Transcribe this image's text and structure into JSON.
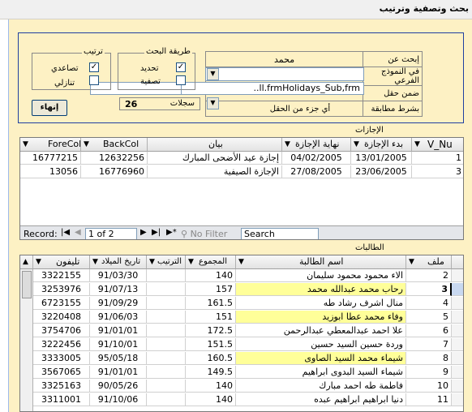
{
  "window": {
    "title": "بحث وتصفية وترتيب"
  },
  "search_panel": {
    "search_for_label": "إبحث عن",
    "search_for_value": "محمد",
    "subform_label": "في النموذج الفرعي",
    "within_field_label": "ضمن حقل",
    "within_field_value": "..ll.frmHolidays_Sub,frm",
    "match_label": "بشرط مطابقة",
    "match_value": "أي جزء من الحقل",
    "records_label": "سجلات",
    "records_count": "26",
    "close_button": "إنهاء",
    "search_method_group": "طريقة البحث",
    "method_select": "تحديد",
    "method_filter": "تصفية",
    "sort_group": "ترتيب",
    "sort_asc": "تصاعدي",
    "sort_desc": "تنازلي"
  },
  "holidays": {
    "section_title": "الإجازات",
    "columns": [
      "V_Nu",
      "بدء الإجازة",
      "نهاية الإجازة",
      "بيان",
      "BackCol",
      "ForeCol"
    ],
    "rows": [
      {
        "num": "1",
        "start": "13/01/2005",
        "end": "04/02/2005",
        "desc": "إجازة عيد الأضحى المبارك",
        "back": "12632256",
        "fore": "16777215"
      },
      {
        "num": "3",
        "start": "23/06/2005",
        "end": "27/08/2005",
        "desc": "الإجازة الصيفية",
        "back": "16776960",
        "fore": "13056"
      }
    ],
    "nav": {
      "record_label": "Record:",
      "position": "1 of 2",
      "filter": "No Filter",
      "search": "Search"
    }
  },
  "students": {
    "section_title": "الطالبات",
    "columns": [
      "ملف",
      "اسم الطالبة",
      "المجموع",
      "الترتيب",
      "تاريخ الميلاد",
      "تليفون"
    ],
    "rows": [
      {
        "file": "2",
        "name": "الاء محمود محمود سليمان",
        "total": "140",
        "rank": "",
        "dob": "91/03/30",
        "phone": "3322155",
        "hl": false
      },
      {
        "file": "3",
        "name": "رحاب محمد عبدالله محمد",
        "total": "157",
        "rank": "",
        "dob": "91/07/13",
        "phone": "3253976",
        "hl": true
      },
      {
        "file": "4",
        "name": "منال اشرف رشاد طه",
        "total": "161.5",
        "rank": "",
        "dob": "91/09/29",
        "phone": "6723155",
        "hl": false
      },
      {
        "file": "5",
        "name": "وفاء محمد عطا ابوزيد",
        "total": "151",
        "rank": "",
        "dob": "91/06/03",
        "phone": "3220408",
        "hl": true
      },
      {
        "file": "6",
        "name": "علا احمد عبدالمعطي عبدالرحمن",
        "total": "172.5",
        "rank": "",
        "dob": "91/01/01",
        "phone": "3754706",
        "hl": false
      },
      {
        "file": "7",
        "name": "وردة حسين السيد حسين",
        "total": "151.5",
        "rank": "",
        "dob": "91/10/01",
        "phone": "3222456",
        "hl": false
      },
      {
        "file": "8",
        "name": "شيماء محمد السيد الصاوى",
        "total": "160.5",
        "rank": "",
        "dob": "95/05/18",
        "phone": "3333005",
        "hl": true
      },
      {
        "file": "9",
        "name": "شيماء السيد البدوى ابراهيم",
        "total": "149.5",
        "rank": "",
        "dob": "91/01/01",
        "phone": "3567065",
        "hl": false
      },
      {
        "file": "10",
        "name": "فاطمة طه احمد مبارك",
        "total": "140",
        "rank": "",
        "dob": "90/05/26",
        "phone": "3325163",
        "hl": false
      },
      {
        "file": "11",
        "name": "دنيا ابراهيم ابراهيم عبده",
        "total": "140",
        "rank": "",
        "dob": "91/10/06",
        "phone": "3311001",
        "hl": false
      }
    ]
  }
}
